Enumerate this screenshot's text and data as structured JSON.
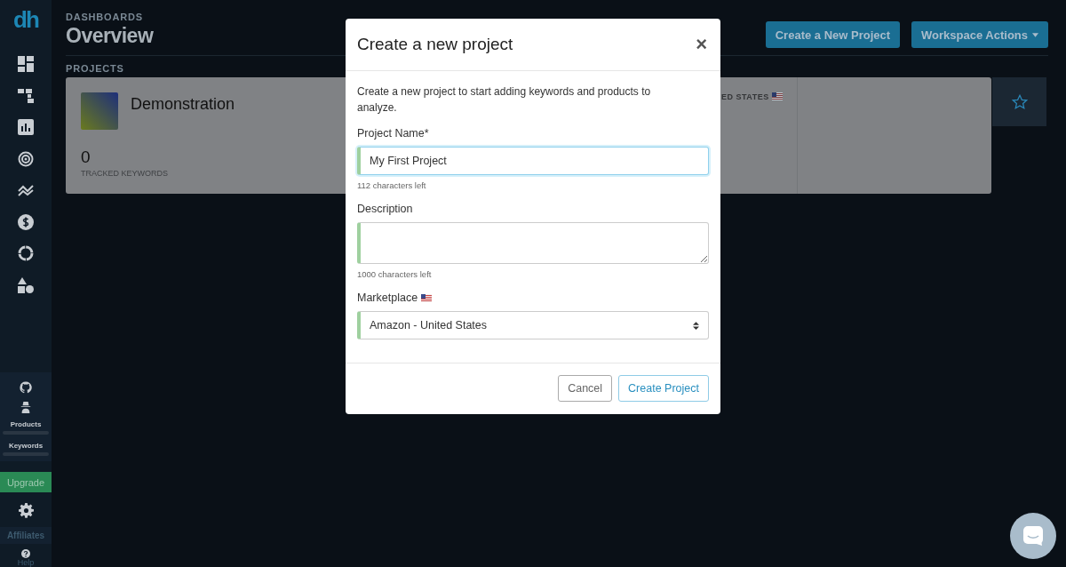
{
  "sidebar": {
    "logo": "dh",
    "usage": [
      {
        "label": "Products",
        "level": 0
      },
      {
        "label": "Keywords",
        "level": 0
      }
    ],
    "upgrade": "Upgrade",
    "affiliates": "Affiliates",
    "help": "Help"
  },
  "header": {
    "breadcrumb": "DASHBOARDS",
    "title": "Overview",
    "buttons": [
      {
        "label": "Create a New Project",
        "dropdown": false
      },
      {
        "label": "Workspace Actions",
        "dropdown": true
      }
    ]
  },
  "projects": {
    "heading": "PROJECTS",
    "cards": [
      {
        "name": "Demonstration",
        "count": "0",
        "count_label": "TRACKED KEYWORDS",
        "marketplace": "ED STATES",
        "starred": false
      }
    ]
  },
  "modal": {
    "title": "Create a new project",
    "close": "×",
    "intro": "Create a new project to start adding keywords and products to analyze.",
    "fields": [
      {
        "kind": "input",
        "label": "Project Name*",
        "flag": false,
        "value": "My First Project",
        "focused": true,
        "hint": "112 characters left"
      },
      {
        "kind": "textarea",
        "label": "Description",
        "flag": false,
        "focused": false,
        "hint": "1000 characters left"
      },
      {
        "kind": "select",
        "label": "Marketplace",
        "flag": true,
        "focused": false,
        "value": "Amazon - United States"
      }
    ],
    "buttons": [
      {
        "label": "Cancel",
        "primary": false
      },
      {
        "label": "Create Project",
        "primary": true
      }
    ]
  }
}
